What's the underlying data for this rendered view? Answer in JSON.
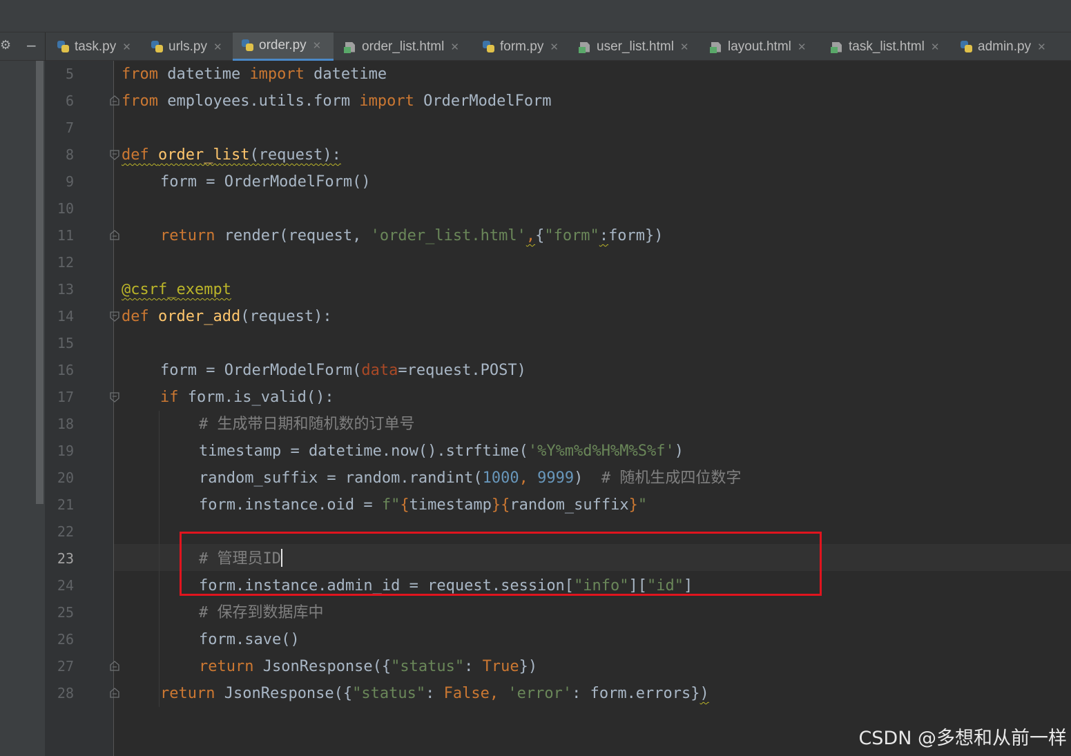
{
  "tabs": [
    {
      "label": "task.py",
      "type": "py"
    },
    {
      "label": "urls.py",
      "type": "py"
    },
    {
      "label": "order.py",
      "type": "py",
      "active": true
    },
    {
      "label": "order_list.html",
      "type": "html"
    },
    {
      "label": "form.py",
      "type": "py"
    },
    {
      "label": "user_list.html",
      "type": "html"
    },
    {
      "label": "layout.html",
      "type": "html"
    },
    {
      "label": "task_list.html",
      "type": "html"
    },
    {
      "label": "admin.py",
      "type": "py"
    }
  ],
  "editor": {
    "current_line": 23,
    "lines": [
      {
        "num": "5",
        "indent": 0,
        "tokens": [
          [
            "kw",
            "from"
          ],
          [
            "",
            " datetime "
          ],
          [
            "kw",
            "import"
          ],
          [
            "",
            " datetime"
          ]
        ]
      },
      {
        "num": "6",
        "indent": 0,
        "fold": "end",
        "tokens": [
          [
            "kw",
            "from"
          ],
          [
            "",
            " employees.utils.form "
          ],
          [
            "kw",
            "import"
          ],
          [
            "",
            " OrderModelForm"
          ]
        ]
      },
      {
        "num": "7",
        "indent": 0,
        "tokens": []
      },
      {
        "num": "8",
        "indent": 0,
        "fold": "start",
        "tokens": [
          [
            "kw squig",
            "def "
          ],
          [
            "fn squig",
            "order_list"
          ],
          [
            "squig",
            "(request):"
          ]
        ]
      },
      {
        "num": "9",
        "indent": 4,
        "tokens": [
          [
            "",
            "form = OrderModelForm()"
          ]
        ]
      },
      {
        "num": "10",
        "indent": 0,
        "tokens": []
      },
      {
        "num": "11",
        "indent": 4,
        "fold": "end",
        "tokens": [
          [
            "kw",
            "return"
          ],
          [
            "",
            " render(request, "
          ],
          [
            "str",
            "'order_list.html'"
          ],
          [
            "kw squig",
            ","
          ],
          [
            "",
            "{"
          ],
          [
            "str",
            "\"form\""
          ],
          [
            "squig",
            ":"
          ],
          [
            "",
            "form})"
          ]
        ]
      },
      {
        "num": "12",
        "indent": 0,
        "tokens": []
      },
      {
        "num": "13",
        "indent": 0,
        "tokens": [
          [
            "dec squig",
            "@csrf_exempt"
          ]
        ]
      },
      {
        "num": "14",
        "indent": 0,
        "fold": "start",
        "tokens": [
          [
            "kw",
            "def "
          ],
          [
            "fn",
            "order_add"
          ],
          [
            "",
            "(request):"
          ]
        ]
      },
      {
        "num": "15",
        "indent": 0,
        "tokens": []
      },
      {
        "num": "16",
        "indent": 4,
        "tokens": [
          [
            "",
            "form = OrderModelForm("
          ],
          [
            "prm",
            "data"
          ],
          [
            "",
            "=request.POST)"
          ]
        ]
      },
      {
        "num": "17",
        "indent": 4,
        "fold": "start",
        "tokens": [
          [
            "kw",
            "if"
          ],
          [
            "",
            " form.is_valid():"
          ]
        ]
      },
      {
        "num": "18",
        "indent": 8,
        "tokens": [
          [
            "cmt",
            "# 生成带日期和随机数的订单号"
          ]
        ]
      },
      {
        "num": "19",
        "indent": 8,
        "tokens": [
          [
            "",
            "timestamp = datetime.now().strftime("
          ],
          [
            "str",
            "'%Y%m%d%H%M%S%f'"
          ],
          [
            "",
            ")"
          ]
        ]
      },
      {
        "num": "20",
        "indent": 8,
        "tokens": [
          [
            "",
            "random_suffix = random.randint("
          ],
          [
            "num",
            "1000"
          ],
          [
            "kw",
            ","
          ],
          [
            "",
            " "
          ],
          [
            "num",
            "9999"
          ],
          [
            "",
            ")  "
          ],
          [
            "cmt",
            "# 随机生成四位数字"
          ]
        ]
      },
      {
        "num": "21",
        "indent": 8,
        "tokens": [
          [
            "",
            "form.instance.oid = "
          ],
          [
            "str",
            "f\""
          ],
          [
            "kw",
            "{"
          ],
          [
            "",
            "timestamp"
          ],
          [
            "kw",
            "}{"
          ],
          [
            "",
            "random_suffix"
          ],
          [
            "kw",
            "}"
          ],
          [
            "str",
            "\""
          ]
        ]
      },
      {
        "num": "22",
        "indent": 0,
        "tokens": []
      },
      {
        "num": "23",
        "indent": 8,
        "caret": true,
        "tokens": [
          [
            "cmt",
            "# 管理员ID"
          ]
        ]
      },
      {
        "num": "24",
        "indent": 8,
        "tokens": [
          [
            "",
            "form.instance.admin_id = request.session["
          ],
          [
            "str",
            "\"info\""
          ],
          [
            "",
            "]["
          ],
          [
            "str",
            "\"id\""
          ],
          [
            "",
            "]"
          ]
        ]
      },
      {
        "num": "25",
        "indent": 8,
        "tokens": [
          [
            "cmt",
            "# 保存到数据库中"
          ]
        ]
      },
      {
        "num": "26",
        "indent": 8,
        "tokens": [
          [
            "",
            "form.save()"
          ]
        ]
      },
      {
        "num": "27",
        "indent": 8,
        "fold": "end",
        "tokens": [
          [
            "kw",
            "return"
          ],
          [
            "",
            " JsonResponse({"
          ],
          [
            "str",
            "\"status\""
          ],
          [
            "",
            ": "
          ],
          [
            "kw",
            "True"
          ],
          [
            "",
            "})"
          ]
        ]
      },
      {
        "num": "28",
        "indent": 4,
        "fold": "end",
        "tokens": [
          [
            "kw",
            "return"
          ],
          [
            "",
            " JsonResponse({"
          ],
          [
            "str",
            "\"status\""
          ],
          [
            "",
            ": "
          ],
          [
            "kw",
            "False"
          ],
          [
            "kw",
            ","
          ],
          [
            "",
            " "
          ],
          [
            "str",
            "'error'"
          ],
          [
            "",
            ": form.errors}"
          ],
          [
            "squig",
            ")"
          ]
        ]
      }
    ]
  },
  "watermark": "CSDN @多想和从前一样",
  "colors": {
    "highlight_box": "#e0141e",
    "keyword": "#cc7832",
    "function": "#ffc66d",
    "string": "#6a8759",
    "number": "#6897bb",
    "comment": "#808080",
    "decorator": "#bbb529"
  }
}
